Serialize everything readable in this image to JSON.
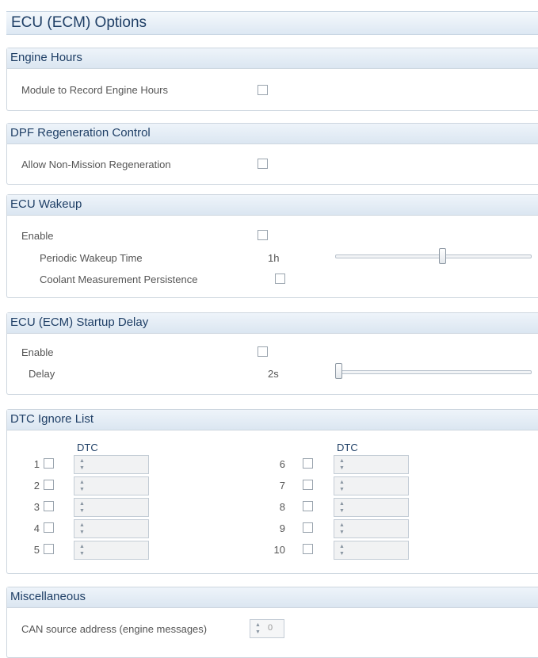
{
  "page_title": "ECU (ECM) Options",
  "engine_hours": {
    "header": "Engine Hours",
    "module_label": "Module to Record Engine Hours",
    "module_checked": false
  },
  "dpf": {
    "header": "DPF Regeneration Control",
    "allow_label": "Allow Non-Mission Regeneration",
    "allow_checked": false
  },
  "ecu_wakeup": {
    "header": "ECU Wakeup",
    "enable_label": "Enable",
    "enable_checked": false,
    "periodic_label": "Periodic Wakeup Time",
    "periodic_value": "1h",
    "periodic_slider_fraction": 0.55,
    "coolant_label": "Coolant Measurement Persistence",
    "coolant_checked": false
  },
  "startup_delay": {
    "header": "ECU (ECM) Startup Delay",
    "enable_label": "Enable",
    "enable_checked": false,
    "delay_label": "Delay",
    "delay_value": "2s",
    "delay_slider_fraction": 0.0
  },
  "dtc_ignore": {
    "header": "DTC Ignore List",
    "column_header_left": "DTC",
    "column_header_right": "DTC",
    "rows_left": [
      {
        "num": "1",
        "checked": false,
        "value": ""
      },
      {
        "num": "2",
        "checked": false,
        "value": ""
      },
      {
        "num": "3",
        "checked": false,
        "value": ""
      },
      {
        "num": "4",
        "checked": false,
        "value": ""
      },
      {
        "num": "5",
        "checked": false,
        "value": ""
      }
    ],
    "rows_right": [
      {
        "num": "6",
        "checked": false,
        "value": ""
      },
      {
        "num": "7",
        "checked": false,
        "value": ""
      },
      {
        "num": "8",
        "checked": false,
        "value": ""
      },
      {
        "num": "9",
        "checked": false,
        "value": ""
      },
      {
        "num": "10",
        "checked": false,
        "value": ""
      }
    ]
  },
  "misc": {
    "header": "Miscellaneous",
    "can_label": "CAN source address (engine messages)",
    "can_value": "0"
  },
  "icons": {
    "spinner_arrows": "spinner-up-down-icon"
  },
  "colors": {
    "header_text": "#1f3f66",
    "header_bg": "#dbe6f1",
    "border": "#cdd6df"
  }
}
